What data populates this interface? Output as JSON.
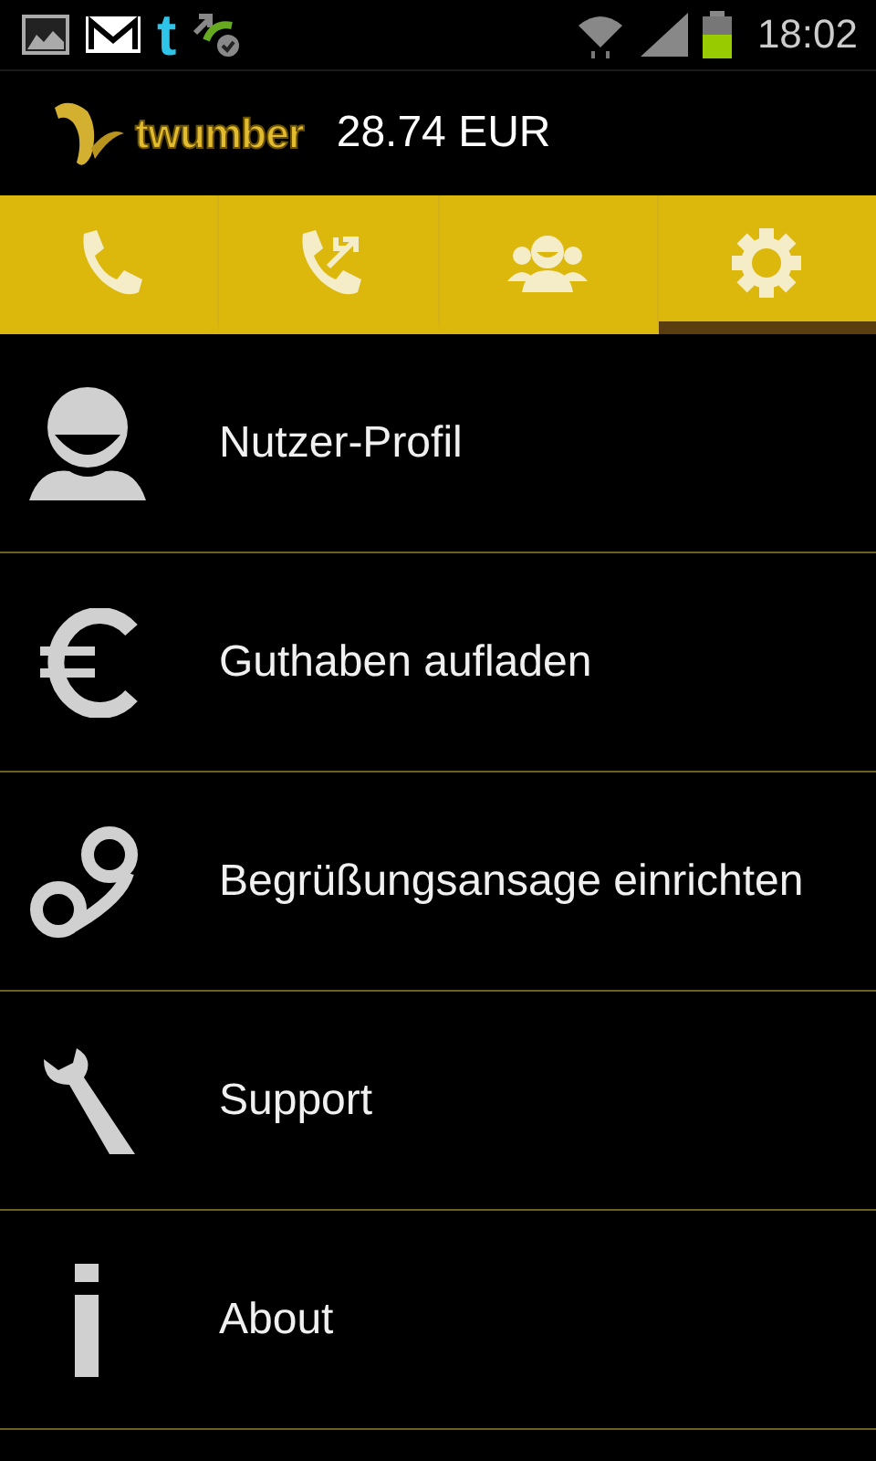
{
  "status_bar": {
    "notifications": [
      {
        "kind": "gallery"
      },
      {
        "kind": "mail"
      },
      {
        "kind": "tumblr",
        "label": "t"
      },
      {
        "kind": "sync"
      }
    ],
    "time": "18:02"
  },
  "header": {
    "logo": "twumber",
    "balance": "28.74 EUR"
  },
  "tabs": [
    {
      "kind": "call",
      "selected": false
    },
    {
      "kind": "transfer",
      "selected": false
    },
    {
      "kind": "contacts",
      "selected": false
    },
    {
      "kind": "settings",
      "selected": true
    }
  ],
  "menu": [
    {
      "kind": "profile",
      "label": "Nutzer-Profil"
    },
    {
      "kind": "euro",
      "label": "Guthaben aufladen"
    },
    {
      "kind": "voicemail",
      "label": "Begrüßungsansage einrichten"
    },
    {
      "kind": "wrench",
      "label": "Support"
    },
    {
      "kind": "info",
      "label": "About"
    }
  ]
}
